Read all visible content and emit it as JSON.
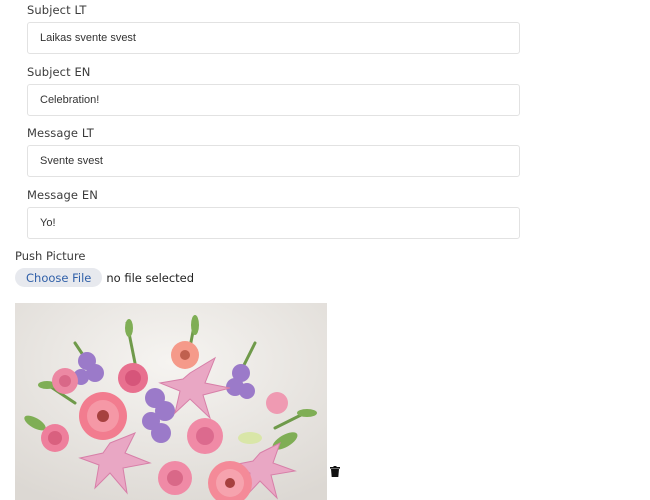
{
  "form": {
    "subject_lt": {
      "label": "Subject LT",
      "value": "Laikas svente svest"
    },
    "subject_en": {
      "label": "Subject EN",
      "value": "Celebration!"
    },
    "message_lt": {
      "label": "Message LT",
      "value": "Svente svest"
    },
    "message_en": {
      "label": "Message EN",
      "value": "Yo!"
    }
  },
  "push_picture": {
    "label": "Push Picture",
    "choose_button": "Choose File",
    "file_status": "no file selected",
    "image_icon": "flower-bouquet-photo",
    "delete_icon": "trash-icon"
  }
}
